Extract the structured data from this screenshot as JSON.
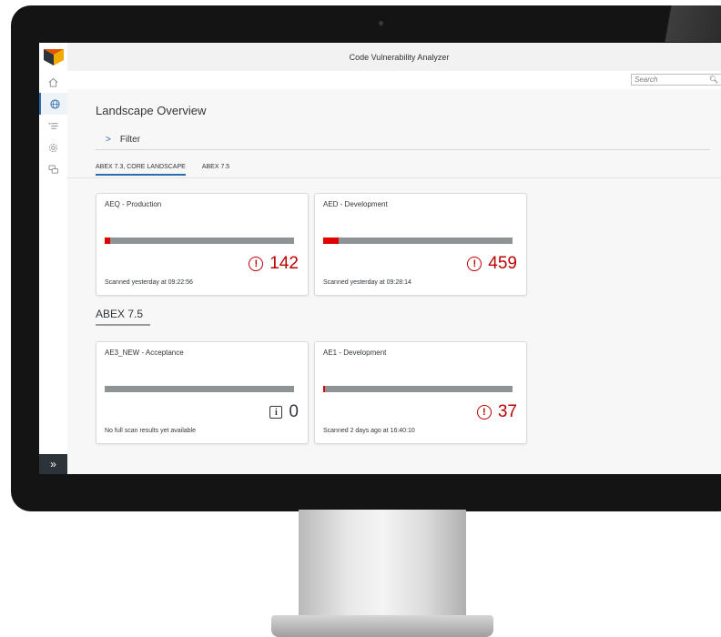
{
  "app": {
    "title": "Code Vulnerability Analyzer"
  },
  "search": {
    "placeholder": "Search"
  },
  "nav": {
    "icons": [
      "home-icon",
      "globe-icon",
      "list-icon",
      "settings-icon",
      "chat-icon"
    ],
    "expand_label": "»"
  },
  "page": {
    "title": "Landscape Overview",
    "filter_label": "Filter"
  },
  "tabs": [
    {
      "label": "ABEX 7.3, CORE LANDSCAPE",
      "active": true
    },
    {
      "label": "ABEX 7.5",
      "active": false
    }
  ],
  "sections": [
    {
      "title": "",
      "cards": [
        {
          "title": "AEQ - Production",
          "value": "142",
          "status": "alert",
          "fill_fraction": 0.03,
          "footer": "Scanned yesterday at 09:22:56"
        },
        {
          "title": "AED - Development",
          "value": "459",
          "status": "alert",
          "fill_fraction": 0.08,
          "footer": "Scanned yesterday at 09:28:14"
        }
      ]
    },
    {
      "title": "ABEX 7.5",
      "cards": [
        {
          "title": "AE3_NEW - Acceptance",
          "value": "0",
          "status": "info",
          "fill_fraction": 0.0,
          "footer": "No full scan results yet available"
        },
        {
          "title": "AE1 - Development",
          "value": "37",
          "status": "alert",
          "fill_fraction": 0.01,
          "footer": "Scanned 2 days ago at 16:40:10"
        }
      ]
    }
  ],
  "colors": {
    "accent": "#2b6cb0",
    "critical": "#bb0000",
    "bar_track": "#8e9396",
    "bar_fill": "#e00000"
  }
}
